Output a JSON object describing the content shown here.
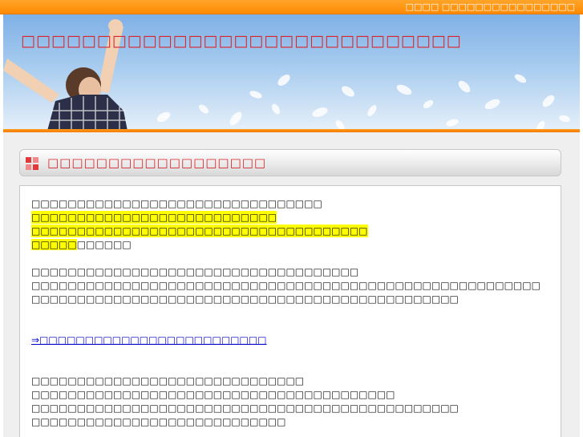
{
  "topbar": {
    "text": "□□□□ □□□□□□□□□□□□□□□□"
  },
  "header": {
    "site_title": "□□□□□□□□□□□□□□□□□□□□□□□□□□□□□"
  },
  "section": {
    "title": "□□□□□□□□□□□□□□□□□□"
  },
  "article": {
    "para1": [
      "□□□□□□□□□□□□□□□□□□□□□□□□□□□□□□□□",
      "□□□□□□□□□□□□□□□□□□□□□□□□□□□",
      "□□□□□□□□□□□□□□□□□□□□□□□□□□□□□□□□□□□□□",
      "□□□□□"
    ],
    "para1_tail": "□□□□□□",
    "para2": [
      "□□□□□□□□□□□□□□□□□□□□□□□□□□□□□□□□□□□□",
      "□□□□□□□□□□□□□□□□□□□□□□□□□□□□□□□□□□□□□□□□□□□□□□□□□□□□□□□□",
      "□□□□□□□□□□□□□□□□□□□□□□□□□□□□□□□□□□□□□□□□□□□□□□□"
    ],
    "link": "⇒□□□□□□□□□□□□□□□□□□□□□□□□□",
    "para3": [
      "□□□□□□□□□□□□□□□□□□□□□□□□□□□□□□",
      "□□□□□□□□□□□□□□□□□□□□□□□□□□□□□□□□□□□□□□□□",
      "□□□□□□□□□□□□□□□□□□□□□□□□□□□□□□□□□□□□□□□□□□□□□□□",
      "□□□□□□□□□□□□□□□□□□□□□□□□□□□□"
    ]
  },
  "colors": {
    "accent_orange": "#ff8a00",
    "title_red": "#d7262c",
    "highlight_yellow": "#ffff00",
    "link_blue": "#0000cc"
  },
  "icons": {
    "section_icon": "red-squares-icon"
  }
}
